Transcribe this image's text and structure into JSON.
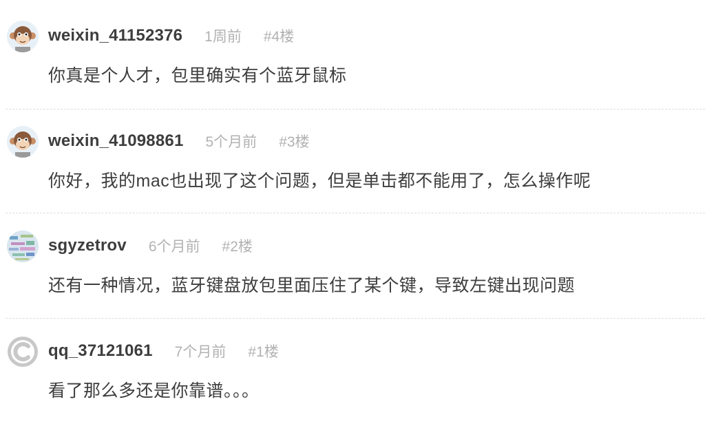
{
  "comments": [
    {
      "avatar_icon": "monkey-avatar-icon",
      "username": "weixin_41152376",
      "time": "1周前",
      "floor": "#4楼",
      "content": "你真是个人才，包里确实有个蓝牙鼠标"
    },
    {
      "avatar_icon": "monkey-avatar-icon",
      "username": "weixin_41098861",
      "time": "5个月前",
      "floor": "#3楼",
      "content": "你好，我的mac也出现了这个问题，但是单击都不能用了，怎么操作呢"
    },
    {
      "avatar_icon": "pattern-avatar-icon",
      "username": "sgyzetrov",
      "time": "6个月前",
      "floor": "#2楼",
      "content": "还有一种情况，蓝牙键盘放包里面压住了某个键，导致左键出现问题"
    },
    {
      "avatar_icon": "c-logo-avatar-icon",
      "username": "qq_37121061",
      "time": "7个月前",
      "floor": "#1楼",
      "content": "看了那么多还是你靠谱。。。"
    }
  ]
}
